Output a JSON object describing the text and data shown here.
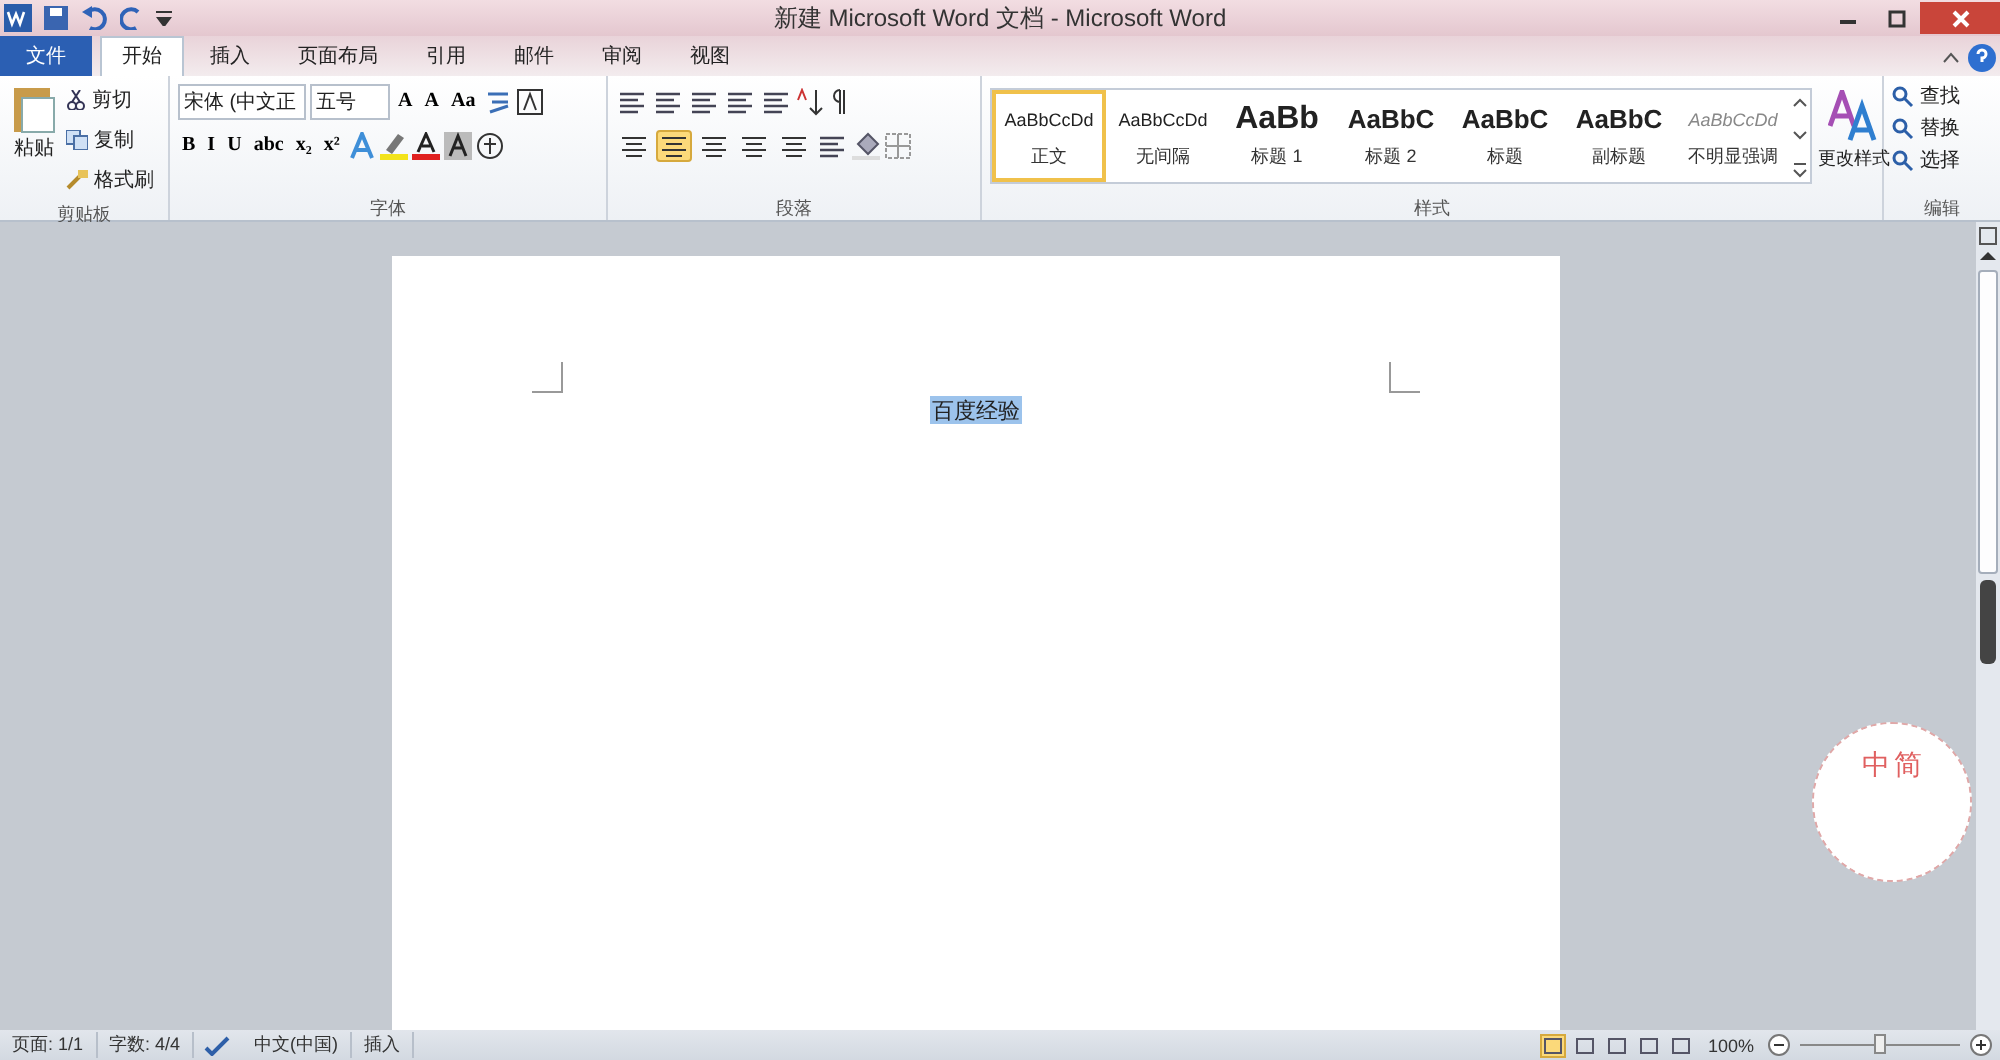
{
  "window": {
    "title": "新建 Microsoft Word 文档 - Microsoft Word"
  },
  "tabs": [
    {
      "label": "文件",
      "kind": "file",
      "selected": false
    },
    {
      "label": "开始",
      "kind": "tab",
      "selected": true
    },
    {
      "label": "插入",
      "kind": "tab",
      "selected": false
    },
    {
      "label": "页面布局",
      "kind": "tab",
      "selected": false
    },
    {
      "label": "引用",
      "kind": "tab",
      "selected": false
    },
    {
      "label": "邮件",
      "kind": "tab",
      "selected": false
    },
    {
      "label": "审阅",
      "kind": "tab",
      "selected": false
    },
    {
      "label": "视图",
      "kind": "tab",
      "selected": false
    }
  ],
  "clipboard": {
    "label": "剪贴板",
    "paste": "粘贴",
    "items": [
      "剪切",
      "复制",
      "格式刷"
    ]
  },
  "font": {
    "label": "字体",
    "font_name": "宋体 (中文正",
    "font_size": "五号",
    "row1_buttons": [
      "A",
      "A",
      "Aa"
    ],
    "row2_buttons": [
      "B",
      "I",
      "U",
      "abc",
      "x₂",
      "x²"
    ]
  },
  "paragraph": {
    "label": "段落",
    "align": [
      {
        "selected": false
      },
      {
        "selected": true
      },
      {
        "selected": false
      },
      {
        "selected": false
      },
      {
        "selected": false
      }
    ]
  },
  "styles": {
    "label": "样式",
    "items": [
      {
        "preview": "AaBbCcDd",
        "name": "正文",
        "kind": "normal",
        "selected": true
      },
      {
        "preview": "AaBbCcDd",
        "name": "无间隔",
        "kind": "normal",
        "selected": false
      },
      {
        "preview": "AaBb",
        "name": "标题 1",
        "kind": "heading1",
        "selected": false
      },
      {
        "preview": "AaBbC",
        "name": "标题 2",
        "kind": "heading2",
        "selected": false
      },
      {
        "preview": "AaBbC",
        "name": "标题",
        "kind": "heading2",
        "selected": false
      },
      {
        "preview": "AaBbC",
        "name": "副标题",
        "kind": "heading2",
        "selected": false
      },
      {
        "preview": "AaBbCcDd",
        "name": "不明显强调",
        "kind": "subtle",
        "selected": false
      }
    ],
    "change": "更改样式"
  },
  "editing": {
    "label": "编辑",
    "items": [
      "查找",
      "替换",
      "选择"
    ]
  },
  "document": {
    "text": "百度经验",
    "selected": true
  },
  "ime_badge": {
    "chars": [
      "中",
      "简"
    ]
  },
  "status_bar": {
    "items": [
      "页面: 1/1",
      "字数: 4/4",
      "中文(中国)",
      "插入"
    ],
    "views": [
      {
        "selected": true
      },
      {
        "selected": false
      },
      {
        "selected": false
      },
      {
        "selected": false
      },
      {
        "selected": false
      }
    ],
    "zoom": "100%",
    "zoom_slider": {
      "level": 0.5
    }
  }
}
